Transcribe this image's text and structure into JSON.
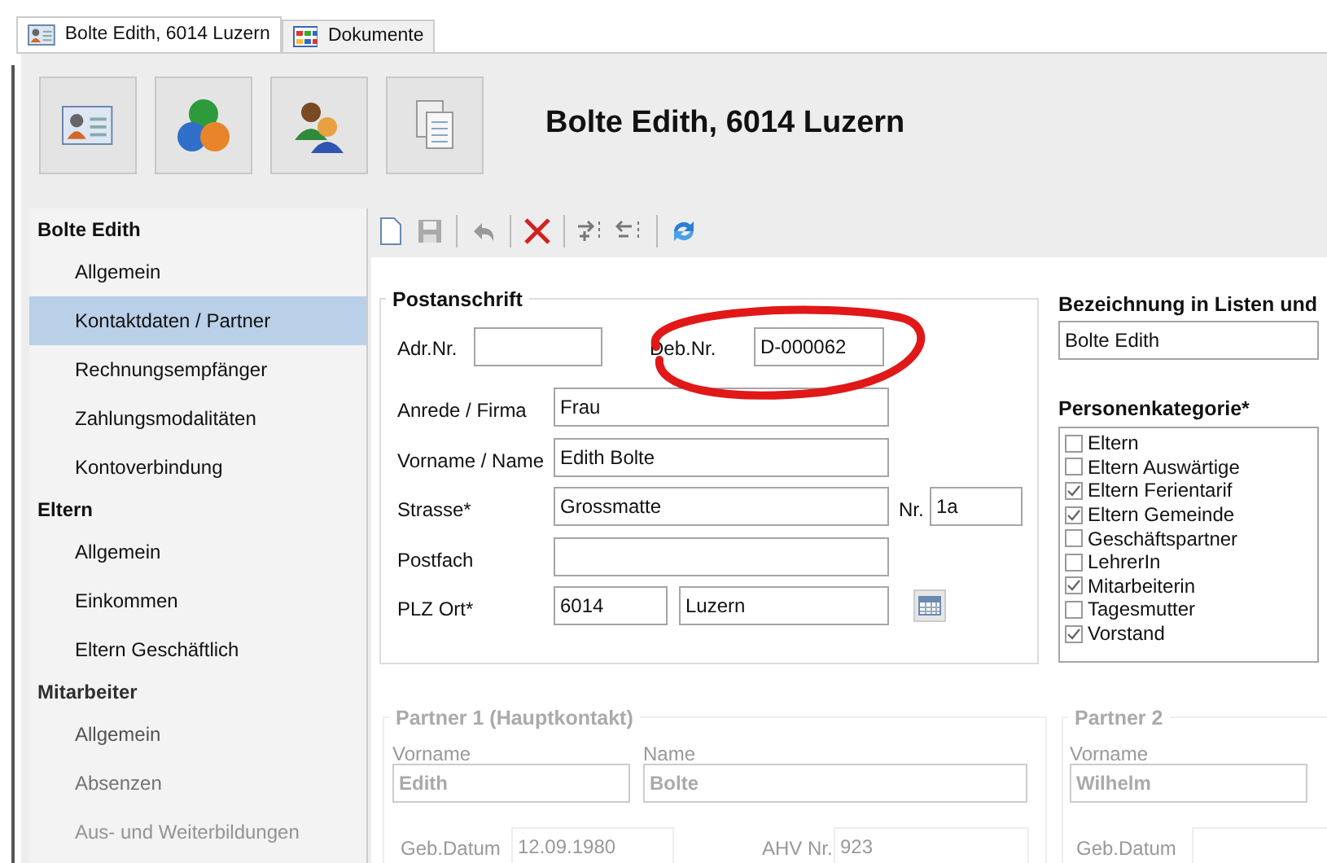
{
  "tabs": [
    {
      "label": "Bolte Edith, 6014 Luzern",
      "kind": "card",
      "selected": true
    },
    {
      "label": "Dokumente",
      "kind": "grid",
      "selected": false
    }
  ],
  "header": {
    "buttons": [
      {
        "kind": "card"
      },
      {
        "kind": "coins"
      },
      {
        "kind": "people"
      },
      {
        "kind": "docs"
      }
    ],
    "title": "Bolte Edith, 6014 Luzern"
  },
  "sidebar": {
    "groups": [
      {
        "title": "Bolte Edith",
        "items": [
          {
            "label": "Allgemein",
            "selected": false
          },
          {
            "label": "Kontaktdaten / Partner",
            "selected": true
          },
          {
            "label": "Rechnungsempfänger",
            "selected": false
          },
          {
            "label": "Zahlungsmodalitäten",
            "selected": false
          },
          {
            "label": "Kontoverbindung",
            "selected": false
          }
        ]
      },
      {
        "title": "Eltern",
        "items": [
          {
            "label": "Allgemein",
            "selected": false
          },
          {
            "label": "Einkommen",
            "selected": false
          },
          {
            "label": "Eltern Geschäftlich",
            "selected": false
          }
        ]
      },
      {
        "title": "Mitarbeiter",
        "items": [
          {
            "label": "Allgemein",
            "selected": false
          },
          {
            "label": "Absenzen",
            "selected": false
          },
          {
            "label": "Aus- und Weiterbildungen",
            "selected": false
          }
        ]
      }
    ]
  },
  "toolbar": [
    {
      "kind": "new"
    },
    {
      "kind": "save"
    },
    {
      "kind": "sep"
    },
    {
      "kind": "undo"
    },
    {
      "kind": "sep"
    },
    {
      "kind": "delete"
    },
    {
      "kind": "sep"
    },
    {
      "kind": "add"
    },
    {
      "kind": "remove"
    },
    {
      "kind": "sep"
    },
    {
      "kind": "refresh"
    }
  ],
  "postanschrift": {
    "title": "Postanschrift",
    "adr_label": "Adr.Nr.",
    "deb_label": "Deb.Nr.",
    "deb_value": "D-000062",
    "highlighted": true,
    "anrede_label": "Anrede / Firma",
    "anrede": "Frau",
    "name_label": "Vorname / Name",
    "name": "Edith Bolte",
    "strasse_label": "Strasse*",
    "strasse": "Grossmatte",
    "nr_label": "Nr.",
    "nr": "1a",
    "postfach_label": "Postfach",
    "plz_label": "PLZ Ort*",
    "plz": "6014",
    "ort": "Luzern"
  },
  "bezeichnung": {
    "title": "Bezeichnung in Listen und",
    "value": "Bolte Edith"
  },
  "personenkategorie": {
    "title": "Personenkategorie*",
    "items": [
      {
        "label": "Eltern",
        "checked": false
      },
      {
        "label": "Eltern Auswärtige",
        "checked": false
      },
      {
        "label": "Eltern Ferientarif",
        "checked": true
      },
      {
        "label": "Eltern Gemeinde",
        "checked": true
      },
      {
        "label": "Geschäftspartner",
        "checked": false
      },
      {
        "label": "LehrerIn",
        "checked": false
      },
      {
        "label": "Mitarbeiterin",
        "checked": true
      },
      {
        "label": "Tagesmutter",
        "checked": false
      },
      {
        "label": "Vorstand",
        "checked": true
      }
    ]
  },
  "partner1": {
    "title": "Partner 1 (Hauptkontakt)",
    "vorname_label": "Vorname",
    "vorname": "Edith",
    "name_label": "Name",
    "name": "Bolte",
    "geb_label": "Geb.Datum",
    "geb": "12.09.1980",
    "ahv_label": "AHV Nr.",
    "ahv": "923"
  },
  "partner2": {
    "title": "Partner 2",
    "vorname_label": "Vorname",
    "vorname": "Wilhelm",
    "geb_label": "Geb.Datum"
  }
}
